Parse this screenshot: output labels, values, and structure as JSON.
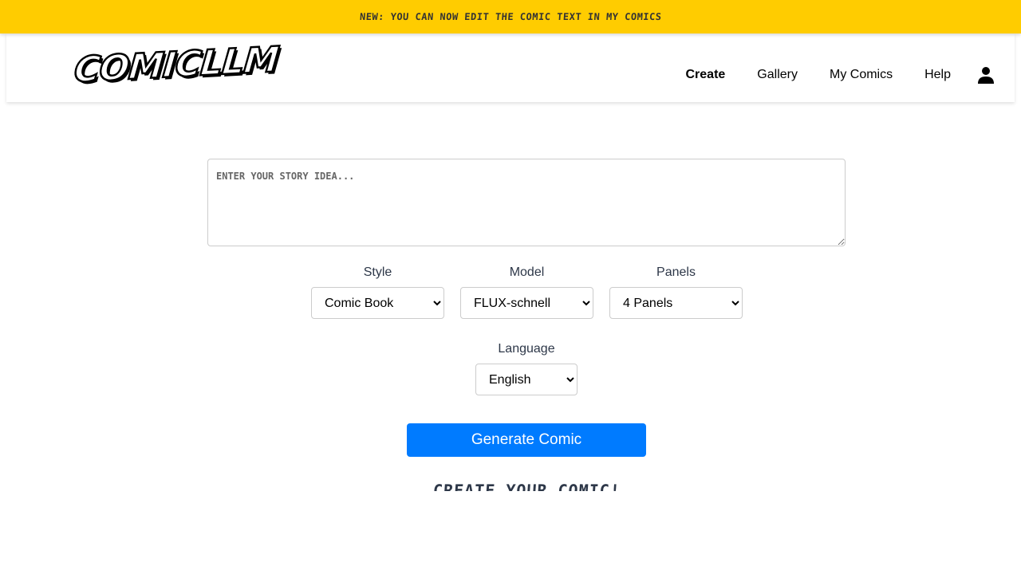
{
  "banner": {
    "text": "New: You can now edit the comic text in My Comics"
  },
  "header": {
    "logo_text": "COMICLLM",
    "nav": [
      {
        "label": "Create",
        "active": true
      },
      {
        "label": "Gallery",
        "active": false
      },
      {
        "label": "My Comics",
        "active": false
      },
      {
        "label": "Help",
        "active": false
      }
    ],
    "user_icon": "user-icon"
  },
  "form": {
    "story_placeholder": "Enter your story idea...",
    "story_value": "",
    "style": {
      "label": "Style",
      "selected": "Comic Book"
    },
    "model": {
      "label": "Model",
      "selected": "FLUX-schnell"
    },
    "panels": {
      "label": "Panels",
      "selected": "4 Panels"
    },
    "language": {
      "label": "Language",
      "selected": "English"
    },
    "generate_label": "Generate Comic"
  },
  "section_title": "Create Your Comic!",
  "colors": {
    "banner_bg": "#ffcc00",
    "primary_button": "#007bff",
    "label_text": "#2d3748"
  }
}
